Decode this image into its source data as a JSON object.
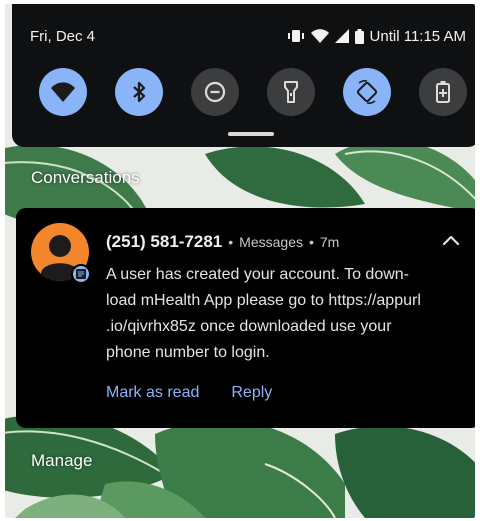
{
  "status_bar": {
    "date": "Fri, Dec 4",
    "alarm_text": "Until 11:15 AM",
    "icons": [
      "vibrate-icon",
      "wifi-icon",
      "cellular-signal-icon",
      "battery-icon"
    ]
  },
  "quick_settings": {
    "tiles": [
      {
        "name": "wifi",
        "icon": "wifi-icon",
        "state": "on"
      },
      {
        "name": "bluetooth",
        "icon": "bluetooth-icon",
        "state": "on"
      },
      {
        "name": "do-not-disturb",
        "icon": "do-not-disturb-icon",
        "state": "off"
      },
      {
        "name": "flashlight",
        "icon": "flashlight-icon",
        "state": "off"
      },
      {
        "name": "auto-rotate",
        "icon": "auto-rotate-icon",
        "state": "on"
      },
      {
        "name": "battery-saver",
        "icon": "battery-saver-icon",
        "state": "off"
      }
    ]
  },
  "conversations": {
    "header": "Conversations"
  },
  "notification": {
    "sender": "(251) 581-7281",
    "app": "Messages",
    "time": "7m",
    "separator": "•",
    "message_lines": [
      "A user has created your account. To down-",
      "load mHealth App please go to https://appurl",
      ".io/qivrhx85z once downloaded use your",
      "phone number to login."
    ],
    "actions": {
      "mark_as_read": "Mark as read",
      "reply": "Reply"
    }
  },
  "manage": {
    "label": "Manage"
  },
  "colors": {
    "accent": "#8ab4f8",
    "avatar": "#f4862c",
    "card_bg": "#000000",
    "shade_bg": "#0f1011"
  }
}
